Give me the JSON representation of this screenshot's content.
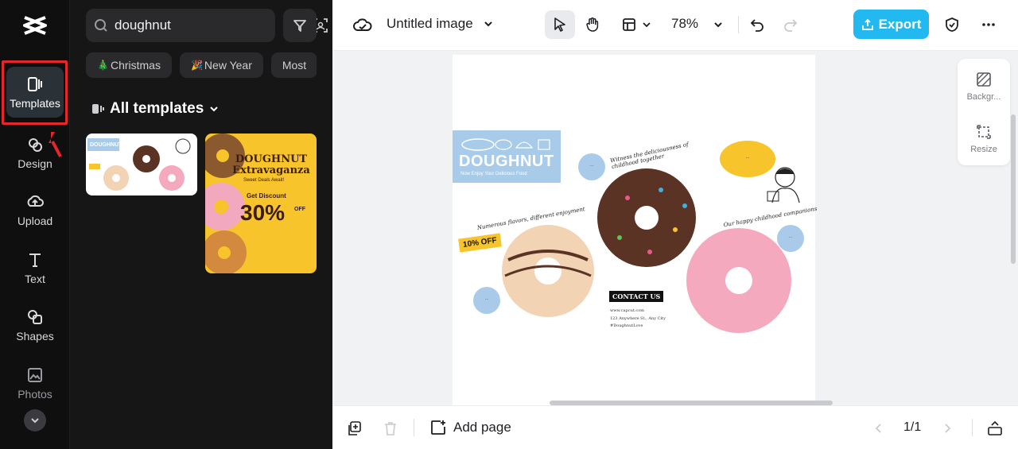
{
  "rail": {
    "items": [
      {
        "label": "Templates"
      },
      {
        "label": "Design"
      },
      {
        "label": "Upload"
      },
      {
        "label": "Text"
      },
      {
        "label": "Shapes"
      },
      {
        "label": "Photos"
      }
    ]
  },
  "panel": {
    "search_value": "doughnut",
    "chips": [
      {
        "emoji": "🎄",
        "label": "Christmas"
      },
      {
        "emoji": "🎉",
        "label": "New Year"
      },
      {
        "emoji": "",
        "label": "Most"
      }
    ],
    "section_title": "All templates",
    "templates": [
      {
        "title": "DOUGHNUT"
      },
      {
        "title": "DOUGHNUT Extravaganza",
        "subtitle": "Sweet Deals Await!",
        "discount_label": "Get Discount",
        "discount": "30%",
        "off": "OFF"
      }
    ]
  },
  "topbar": {
    "doc_title": "Untitled image",
    "zoom": "78%",
    "export_label": "Export"
  },
  "canvas": {
    "poster": {
      "banner_title": "DOUGHNUT",
      "banner_sub": "Now Enjoy Your Delicious Food",
      "caption_1": "Witness the deliciousness of childhood together",
      "caption_2": "Our happy childhood companions",
      "caption_3": "Numerous flavors, different enjoyment",
      "offer": "10% OFF",
      "contact_title": "CONTACT US",
      "contact_lines": [
        "www.capcut.com",
        "123 Anywhere St., Any City",
        "#DoughnutLove"
      ]
    },
    "side_tools": [
      {
        "label": "Backgr..."
      },
      {
        "label": "Resize"
      }
    ]
  },
  "bottombar": {
    "add_page_label": "Add page",
    "page_indicator": "1/1"
  },
  "colors": {
    "accent": "#22b8f0",
    "highlight": "#e5262b",
    "rail_bg": "#0f0f10",
    "panel_bg": "#161617"
  }
}
